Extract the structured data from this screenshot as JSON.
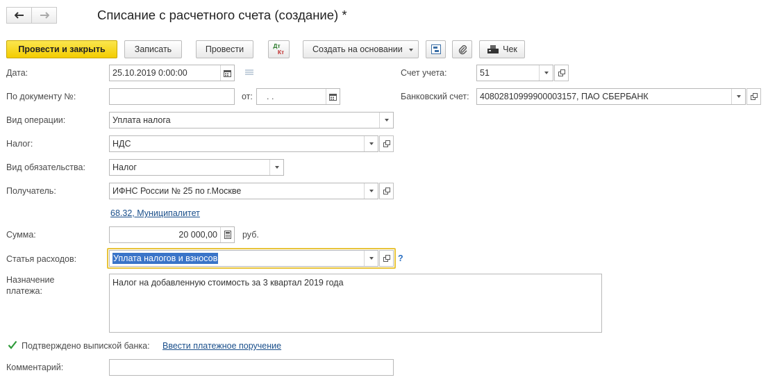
{
  "window": {
    "title": "Списание с расчетного счета (создание) *"
  },
  "nav": {
    "back_icon": "arrow-left-icon",
    "forward_icon": "arrow-right-icon"
  },
  "toolbar": {
    "post_close_label": "Провести и закрыть",
    "save_label": "Записать",
    "post_label": "Провести",
    "dt_kt_top": "Дт",
    "dt_kt_bottom": "Кт",
    "create_based_label": "Создать на основании",
    "receipt_label": "Чек"
  },
  "form": {
    "date": {
      "label": "Дата:",
      "value": "25.10.2019  0:00:00"
    },
    "doc_number": {
      "label": "По документу №:",
      "value": ""
    },
    "from": {
      "label": "от:",
      "value": " .  ."
    },
    "account": {
      "label": "Счет учета:",
      "value": "51"
    },
    "bank_account": {
      "label": "Банковский счет:",
      "value": "40802810999900003157, ПАО СБЕРБАНК"
    },
    "operation": {
      "label": "Вид операции:",
      "value": "Уплата налога"
    },
    "tax": {
      "label": "Налог:",
      "value": "НДС"
    },
    "obligation": {
      "label": "Вид обязательства:",
      "value": "Налог"
    },
    "recipient": {
      "label": "Получатель:",
      "value": "ИФНС России № 25 по г.Москве"
    },
    "recipient_link": "68.32, Муниципалитет",
    "amount": {
      "label": "Сумма:",
      "value": "20 000,00",
      "currency": "руб."
    },
    "expense_item": {
      "label": "Статья расходов:",
      "value": "Уплата налогов и взносов",
      "help": "?"
    },
    "purpose": {
      "label_line1": "Назначение",
      "label_line2": "платежа:",
      "value": "Налог на добавленную стоимость за 3 квартал 2019 года"
    },
    "confirmed": {
      "label": "Подтверждено выпиской банка:",
      "checked": true,
      "link": "Ввести платежное поручение"
    },
    "comment": {
      "label": "Комментарий:",
      "value": ""
    }
  },
  "colors": {
    "primary": "#f5d21c",
    "link": "#1a4f8b",
    "focus": "#e8c43a",
    "selection": "#3a74c8"
  }
}
